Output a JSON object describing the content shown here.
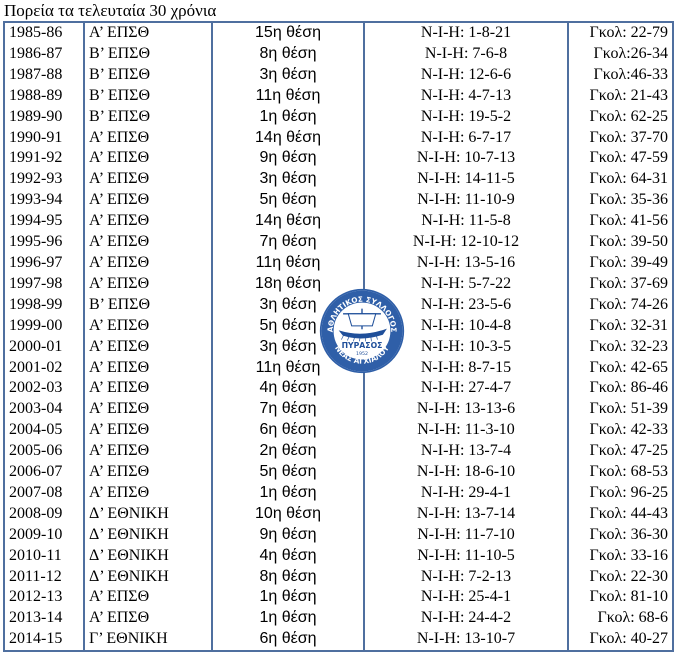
{
  "title": "Πορεία τα τελευταία 30 χρόνια",
  "logo": {
    "top_text": "ΑΘΛΗΤΙΚΟΣ ΣΥΛΛΟΓΟΣ",
    "name": "ΠΥΡΑΣΟΣ",
    "year": "1952",
    "bottom_text": "ΝΕΑΣ ΑΓΧΙΑΛΟΥ",
    "colors": {
      "ring": "#2f5fa8",
      "inner": "#ffffff",
      "ship": "#1f4f9a"
    }
  },
  "colors": {
    "grid": "#4f6f9f"
  },
  "rows": [
    {
      "season": "1985-86",
      "division": "Α’ ΕΠΣΘ",
      "position": "15η θέση",
      "record": "Ν-Ι-Η: 1-8-21",
      "goals": "Γκολ: 22-79"
    },
    {
      "season": "1986-87",
      "division": "Β’ ΕΠΣΘ",
      "position": "8η θέση",
      "record": "Ν-Ι-Η: 7-6-8",
      "goals": "Γκολ:26-34"
    },
    {
      "season": "1987-88",
      "division": "Β’ ΕΠΣΘ",
      "position": "3η θέση",
      "record": "Ν-Ι-Η: 12-6-6",
      "goals": "Γκολ:46-33"
    },
    {
      "season": "1988-89",
      "division": "Β’ ΕΠΣΘ",
      "position": "11η θέση",
      "record": "Ν-Ι-Η: 4-7-13",
      "goals": "Γκολ: 21-43"
    },
    {
      "season": "1989-90",
      "division": "Β’ ΕΠΣΘ",
      "position": "1η θέση",
      "record": "Ν-Ι-Η: 19-5-2",
      "goals": "Γκολ: 62-25"
    },
    {
      "season": "1990-91",
      "division": "Α’ ΕΠΣΘ",
      "position": "14η θέση",
      "record": "Ν-Ι-Η: 6-7-17",
      "goals": "Γκολ: 37-70"
    },
    {
      "season": "1991-92",
      "division": "Α’ ΕΠΣΘ",
      "position": "9η θέση",
      "record": "Ν-Ι-Η: 10-7-13",
      "goals": "Γκολ: 47-59"
    },
    {
      "season": "1992-93",
      "division": "Α’ ΕΠΣΘ",
      "position": "3η θέση",
      "record": "Ν-Ι-Η: 14-11-5",
      "goals": "Γκολ: 64-31"
    },
    {
      "season": "1993-94",
      "division": "Α’ ΕΠΣΘ",
      "position": "5η θέση",
      "record": "Ν-Ι-Η: 11-10-9",
      "goals": "Γκολ: 35-36"
    },
    {
      "season": "1994-95",
      "division": "Α’ ΕΠΣΘ",
      "position": "14η θέση",
      "record": "Ν-Ι-Η: 11-5-8",
      "goals": "Γκολ: 41-56"
    },
    {
      "season": "1995-96",
      "division": "Α’ ΕΠΣΘ",
      "position": "7η θέση",
      "record": "Ν-Ι-Η: 12-10-12",
      "goals": "Γκολ: 39-50"
    },
    {
      "season": "1996-97",
      "division": "Α’ ΕΠΣΘ",
      "position": "11η θέση",
      "record": "Ν-Ι-Η: 13-5-16",
      "goals": "Γκολ: 39-49"
    },
    {
      "season": "1997-98",
      "division": "Α’ ΕΠΣΘ",
      "position": "18η θέση",
      "record": "Ν-Ι-Η: 5-7-22",
      "goals": "Γκολ: 37-69"
    },
    {
      "season": "1998-99",
      "division": "Β’ ΕΠΣΘ",
      "position": "3η θέση",
      "record": "Ν-Ι-Η: 23-5-6",
      "goals": "Γκολ: 74-26"
    },
    {
      "season": "1999-00",
      "division": "Α’ ΕΠΣΘ",
      "position": "5η θέση",
      "record": "Ν-Ι-Η: 10-4-8",
      "goals": "Γκολ: 32-31"
    },
    {
      "season": "2000-01",
      "division": "Α’ ΕΠΣΘ",
      "position": "3η θέση",
      "record": "Ν-Ι-Η: 10-3-5",
      "goals": "Γκολ: 32-23"
    },
    {
      "season": "2001-02",
      "division": "Α’ ΕΠΣΘ",
      "position": "11η θέση",
      "record": "Ν-Ι-Η: 8-7-15",
      "goals": "Γκολ: 42-65"
    },
    {
      "season": "2002-03",
      "division": "Α’ ΕΠΣΘ",
      "position": "4η θέση",
      "record": "Ν-Ι-Η: 27-4-7",
      "goals": "Γκολ: 86-46"
    },
    {
      "season": "2003-04",
      "division": "Α’ ΕΠΣΘ",
      "position": "7η θέση",
      "record": "Ν-Ι-Η: 13-13-6",
      "goals": "Γκολ: 51-39"
    },
    {
      "season": "2004-05",
      "division": "Α’ ΕΠΣΘ",
      "position": "6η θέση",
      "record": "Ν-Ι-Η: 11-3-10",
      "goals": "Γκολ: 42-33"
    },
    {
      "season": "2005-06",
      "division": "Α’ ΕΠΣΘ",
      "position": "2η θέση",
      "record": "Ν-Ι-Η: 13-7-4",
      "goals": "Γκολ: 47-25"
    },
    {
      "season": "2006-07",
      "division": "Α’ ΕΠΣΘ",
      "position": "5η θέση",
      "record": "Ν-Ι-Η: 18-6-10",
      "goals": "Γκολ: 68-53"
    },
    {
      "season": "2007-08",
      "division": "Α’ ΕΠΣΘ",
      "position": "1η θέση",
      "record": "Ν-Ι-Η: 29-4-1",
      "goals": "Γκολ: 96-25"
    },
    {
      "season": "2008-09",
      "division": "Δ’ ΕΘΝΙΚΗ",
      "position": "10η θέση",
      "record": "Ν-Ι-Η: 13-7-14",
      "goals": "Γκολ: 44-43"
    },
    {
      "season": "2009-10",
      "division": "Δ’ ΕΘΝΙΚΗ",
      "position": "9η θέση",
      "record": "Ν-Ι-Η: 11-7-10",
      "goals": "Γκολ: 36-30"
    },
    {
      "season": "2010-11",
      "division": "Δ’ ΕΘΝΙΚΗ",
      "position": "4η θέση",
      "record": "Ν-Ι-Η: 11-10-5",
      "goals": "Γκολ: 33-16"
    },
    {
      "season": "2011-12",
      "division": "Δ’ ΕΘΝΙΚΗ",
      "position": "8η θέση",
      "record": "Ν-Ι-Η: 7-2-13",
      "goals": "Γκολ: 22-30"
    },
    {
      "season": "2012-13",
      "division": "Α’ ΕΠΣΘ",
      "position": "1η θέση",
      "record": "Ν-Ι-Η: 25-4-1",
      "goals": "Γκολ: 81-10"
    },
    {
      "season": "2013-14",
      "division": "Α’ ΕΠΣΘ",
      "position": "1η θέση",
      "record": "Ν-Ι-Η: 24-4-2",
      "goals": "Γκολ: 68-6"
    },
    {
      "season": "2014-15",
      "division": "Γ’ ΕΘΝΙΚΗ",
      "position": "6η θέση",
      "record": "Ν-Ι-Η: 13-10-7",
      "goals": "Γκολ: 40-27"
    }
  ]
}
